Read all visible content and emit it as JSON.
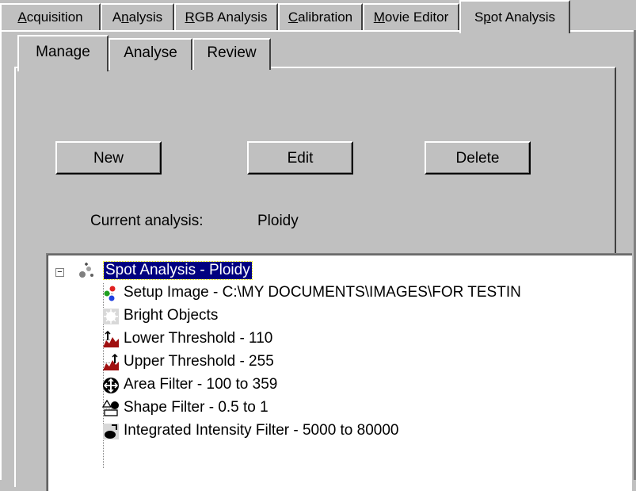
{
  "outer_tabs": [
    {
      "pre": "",
      "key": "A",
      "post": "cquisition"
    },
    {
      "pre": "A",
      "key": "n",
      "post": "alysis"
    },
    {
      "pre": "",
      "key": "R",
      "post": "GB Analysis"
    },
    {
      "pre": "",
      "key": "C",
      "post": "alibration"
    },
    {
      "pre": "",
      "key": "M",
      "post": "ovie Editor"
    },
    {
      "pre": "S",
      "key": "p",
      "post": "ot Analysis"
    }
  ],
  "inner_tabs": [
    "Manage",
    "Analyse",
    "Review"
  ],
  "buttons": {
    "new": "New",
    "edit": "Edit",
    "delete": "Delete"
  },
  "current_analysis": {
    "label": "Current analysis:",
    "value": "Ploidy"
  },
  "tree": {
    "expander": "−",
    "root": "Spot Analysis - Ploidy",
    "items": [
      {
        "icon": "setup-image-icon",
        "label": "Setup Image - C:\\MY DOCUMENTS\\IMAGES\\FOR TESTIN"
      },
      {
        "icon": "bright-objects-icon",
        "label": "Bright Objects"
      },
      {
        "icon": "lower-threshold-icon",
        "label": "Lower Threshold - 110"
      },
      {
        "icon": "upper-threshold-icon",
        "label": "Upper Threshold - 255"
      },
      {
        "icon": "area-filter-icon",
        "label": "Area Filter - 100 to 359"
      },
      {
        "icon": "shape-filter-icon",
        "label": "Shape Filter - 0.5 to 1"
      },
      {
        "icon": "integrated-intensity-filter-icon",
        "label": "Integrated Intensity Filter - 5000 to 80000"
      }
    ]
  },
  "colors": {
    "face": "#c0c0c0",
    "selection": "#000080",
    "window": "#ffffff"
  }
}
